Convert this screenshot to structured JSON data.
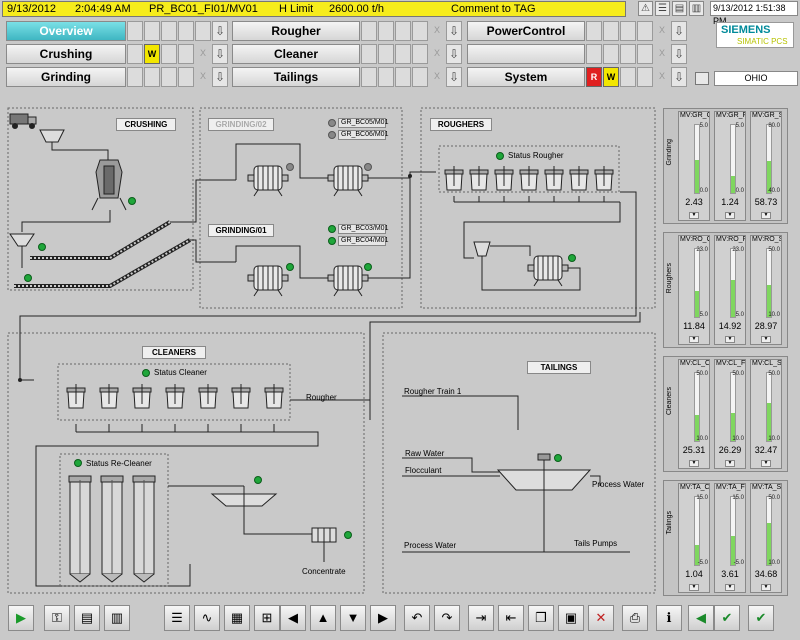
{
  "header": {
    "date": "9/13/2012",
    "time": "2:04:49 AM",
    "tag": "PR_BC01_FI01/MV01",
    "limit_label": "H Limit",
    "limit_value": "2600.00 t/h",
    "comment": "Comment to TAG",
    "clock": "9/13/2012 1:51:38 PM"
  },
  "nav": {
    "overview": "Overview",
    "crushing": "Crushing",
    "grinding": "Grinding",
    "rougher": "Rougher",
    "cleaner": "Cleaner",
    "tailings": "Tailings",
    "powercontrol": "PowerControl",
    "system": "System",
    "w": "W",
    "r": "R",
    "x": "X",
    "arrow": "⇩"
  },
  "brand": {
    "name": "SIEMENS",
    "sub": "SIMATIC PCS"
  },
  "station": "OHIO",
  "sections": {
    "crushing": "CRUSHING",
    "grinding02": "GRINDING/02",
    "grinding01": "GRINDING/01",
    "roughers": "ROUGHERS",
    "cleaners": "CLEANERS",
    "tailings": "TAILINGS"
  },
  "tags": {
    "bc05": "GR_BC05/M01",
    "bc06": "GR_BC06/M01",
    "bc03": "GR_BC03/M01",
    "bc04": "GR_BC04/M01"
  },
  "labels": {
    "status_rougher": "Status Rougher",
    "status_cleaner": "Status Cleaner",
    "status_recleaner": "Status Re-Cleaner",
    "rougher": "Rougher",
    "rougher_train": "Rougher Train 1",
    "raw_water": "Raw Water",
    "flocculant": "Flocculant",
    "process_water_out": "Process Water",
    "process_water_in": "Process Water",
    "tails_pumps": "Tails Pumps",
    "concentrate": "Concentrate"
  },
  "panels": [
    {
      "label": "Grinding",
      "gauges": [
        {
          "name": "MV:GR_Cu",
          "max": "5.0",
          "min": "0.0",
          "value": "2.43",
          "level": 0.49
        },
        {
          "name": "MV:GR_Fe",
          "max": "5.0",
          "min": "0.0",
          "value": "1.24",
          "level": 0.25
        },
        {
          "name": "MV:GR_Solid",
          "max": "80.0",
          "min": "40.0",
          "value": "58.73",
          "level": 0.47
        }
      ]
    },
    {
      "label": "Roughers",
      "gauges": [
        {
          "name": "MV:RO_Cu",
          "max": "23.0",
          "min": "5.0",
          "value": "11.84",
          "level": 0.38
        },
        {
          "name": "MV:RO_Fe",
          "max": "23.0",
          "min": "5.0",
          "value": "14.92",
          "level": 0.55
        },
        {
          "name": "MV:RO_Solid",
          "max": "50.0",
          "min": "10.0",
          "value": "28.97",
          "level": 0.47
        }
      ]
    },
    {
      "label": "Cleaners",
      "gauges": [
        {
          "name": "MV:CL_Cu",
          "max": "50.0",
          "min": "10.0",
          "value": "25.31",
          "level": 0.38
        },
        {
          "name": "MV:CL_Fe",
          "max": "50.0",
          "min": "10.0",
          "value": "26.29",
          "level": 0.41
        },
        {
          "name": "MV:CL_Solid",
          "max": "50.0",
          "min": "10.0",
          "value": "32.47",
          "level": 0.56
        }
      ]
    },
    {
      "label": "Tailings",
      "gauges": [
        {
          "name": "MV:TA_Cu",
          "max": "15.0",
          "min": "-5.0",
          "value": "1.04",
          "level": 0.3
        },
        {
          "name": "MV:TA_Fe",
          "max": "15.0",
          "min": "-5.0",
          "value": "3.61",
          "level": 0.43
        },
        {
          "name": "MV:TA_Solid",
          "max": "50.0",
          "min": "10.0",
          "value": "34.68",
          "level": 0.62
        }
      ]
    }
  ],
  "toolbar": [
    {
      "icon": "play-icon",
      "glyph": "▶"
    },
    {
      "icon": "key-icon",
      "glyph": "⚿"
    },
    {
      "icon": "folder-icon",
      "glyph": "▤"
    },
    {
      "icon": "folder-c-icon",
      "glyph": "▥"
    },
    {
      "icon": "list-icon",
      "glyph": "☰"
    },
    {
      "icon": "trend-icon",
      "glyph": "∿"
    },
    {
      "icon": "gauge-icon",
      "glyph": "▦"
    },
    {
      "icon": "tree-icon",
      "glyph": "⊞"
    },
    {
      "icon": "arrow-left-icon",
      "glyph": "◀"
    },
    {
      "icon": "arrow-up-icon",
      "glyph": "▲"
    },
    {
      "icon": "arrow-down-icon",
      "glyph": "▼"
    },
    {
      "icon": "arrow-right-icon",
      "glyph": "▶"
    },
    {
      "icon": "undo-icon",
      "glyph": "↶"
    },
    {
      "icon": "redo-icon",
      "glyph": "↷"
    },
    {
      "icon": "import-icon",
      "glyph": "⇥"
    },
    {
      "icon": "export-icon",
      "glyph": "⇤"
    },
    {
      "icon": "window-icon",
      "glyph": "❐"
    },
    {
      "icon": "save-icon",
      "glyph": "▣"
    },
    {
      "icon": "close-window-icon",
      "glyph": "✕"
    },
    {
      "icon": "printer-icon",
      "glyph": "⎙"
    },
    {
      "icon": "info-icon",
      "glyph": "ℹ"
    },
    {
      "icon": "horn-icon",
      "glyph": "◀"
    },
    {
      "icon": "check-icon",
      "glyph": "✔"
    },
    {
      "icon": "check-all-icon",
      "glyph": "✔"
    }
  ]
}
